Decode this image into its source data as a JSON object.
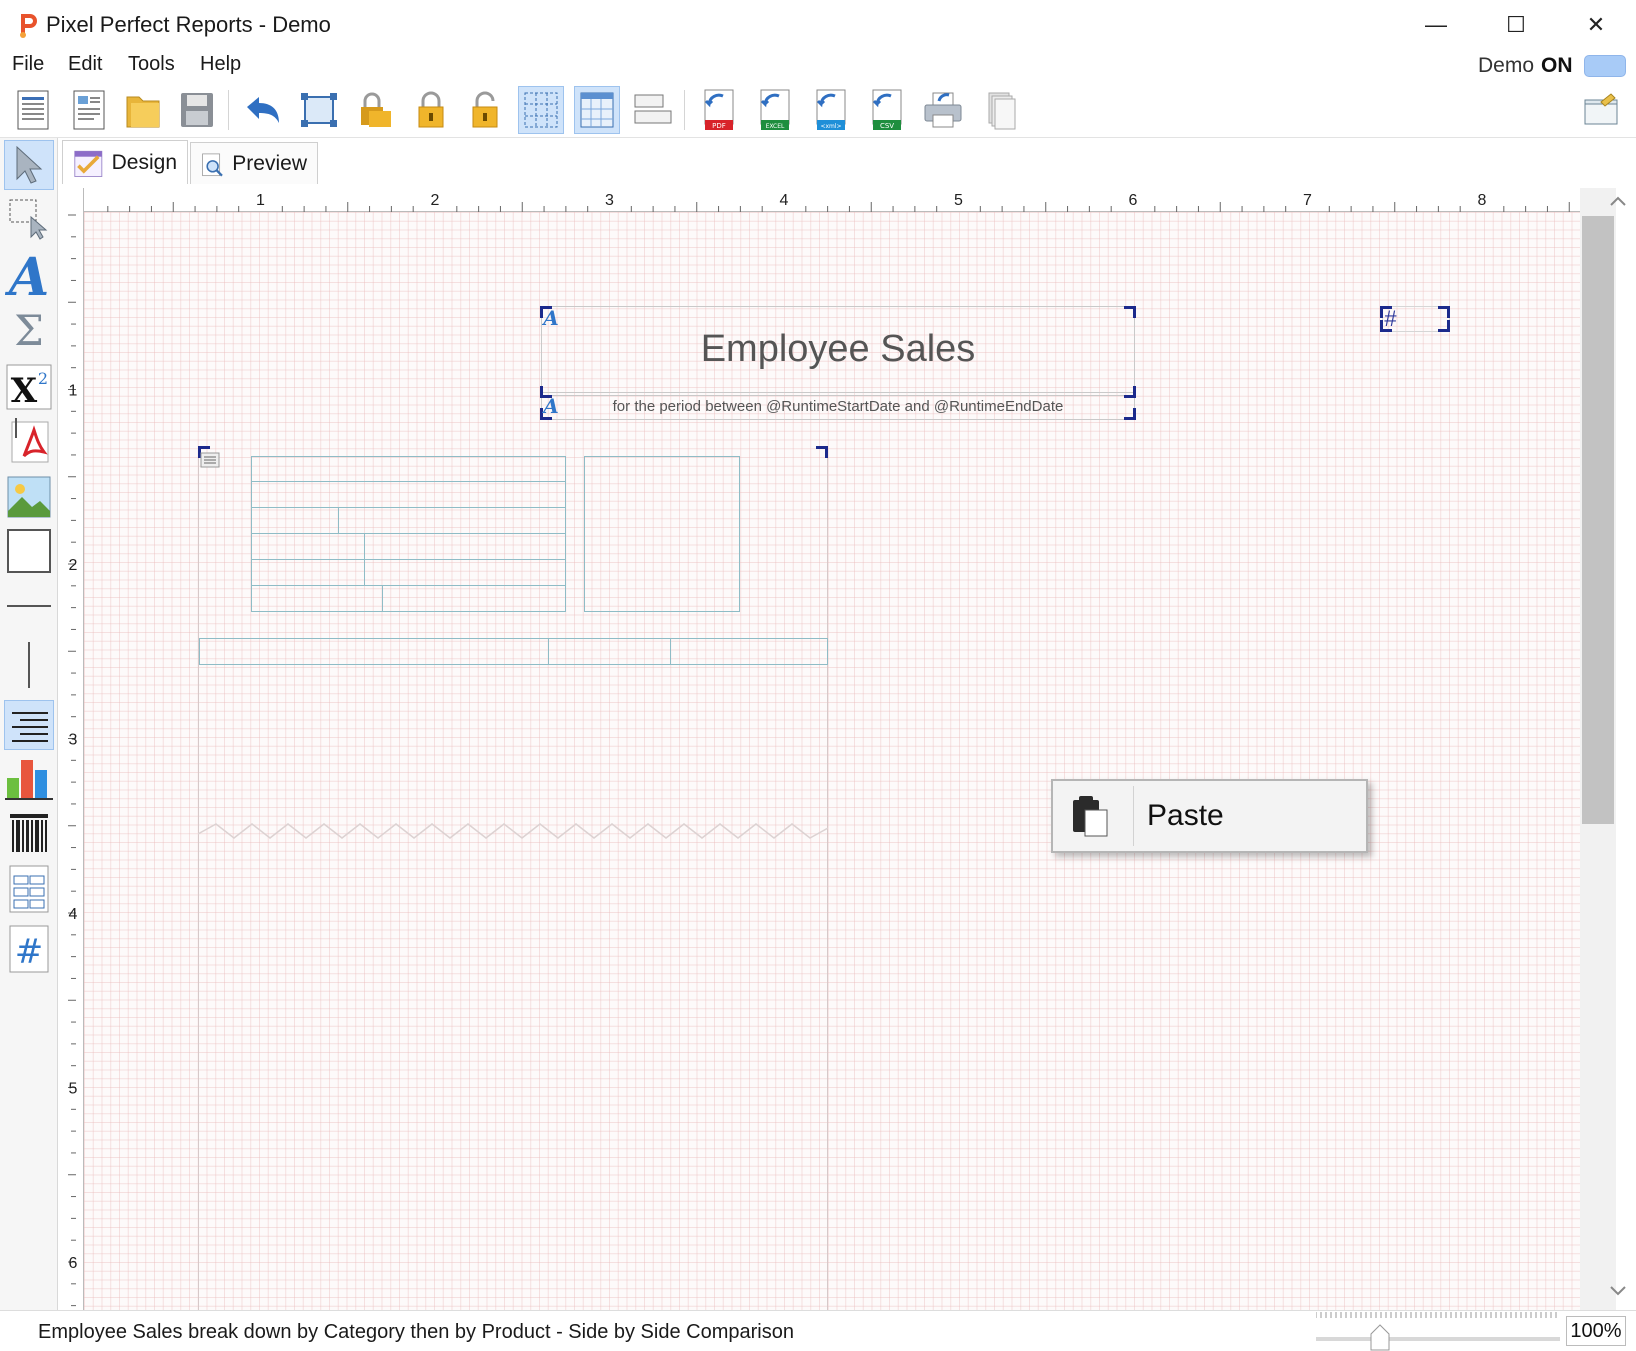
{
  "window": {
    "title": "Pixel Perfect Reports - Demo",
    "minimize_glyph": "—",
    "maximize_glyph": "☐",
    "close_glyph": "✕"
  },
  "menu": {
    "items": [
      "File",
      "Edit",
      "Tools",
      "Help"
    ],
    "demo_label": "Demo",
    "demo_state": "ON"
  },
  "toolbar": {
    "export_labels": {
      "pdf": "PDF",
      "excel": "EXCEL",
      "xml": "<xml>",
      "csv": "CSV"
    }
  },
  "tabs": {
    "design": "Design",
    "preview": "Preview"
  },
  "ruler": {
    "horizontal": [
      "1",
      "2",
      "3",
      "4",
      "5",
      "6",
      "7",
      "8"
    ],
    "vertical": [
      "1",
      "2",
      "3",
      "4",
      "5",
      "6"
    ]
  },
  "report": {
    "title": "Employee Sales",
    "subtitle": "for the period between @RuntimeStartDate and @RuntimeEndDate",
    "page_number_symbol": "#"
  },
  "context_menu": {
    "paste_label": "Paste"
  },
  "status": {
    "text": "Employee Sales break down by Category then by Product - Side by Side Comparison",
    "zoom": "100%"
  },
  "tool_palette": {
    "text_glyph": "A",
    "sum_glyph": "Σ",
    "superscript_glyph": "X",
    "superscript_exp": "2",
    "field_glyph": "#"
  }
}
